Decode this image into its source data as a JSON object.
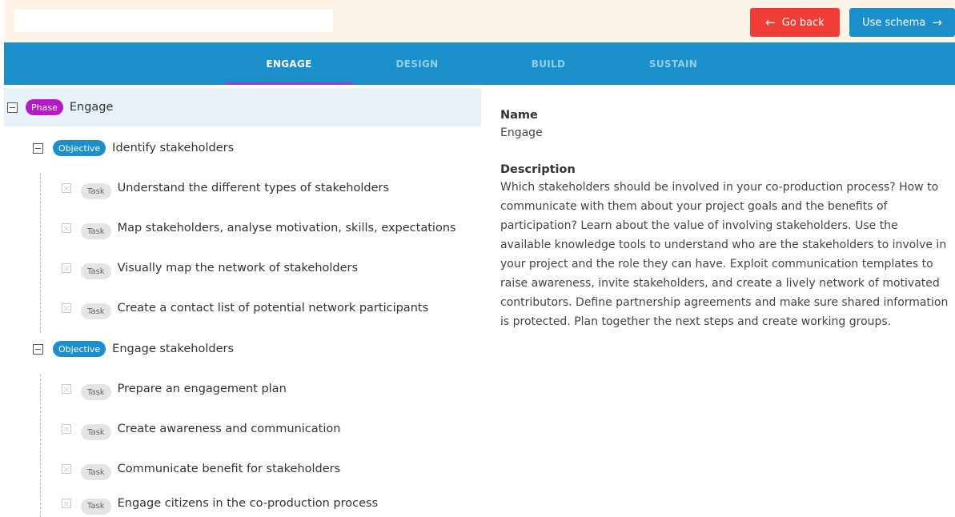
{
  "header": {
    "search_value": "",
    "go_back_label": "Go back",
    "use_schema_label": "Use schema",
    "go_back_color": "#ef3d36",
    "use_schema_color": "#1b8fc9"
  },
  "tabs": [
    {
      "label": "ENGAGE",
      "active": true
    },
    {
      "label": "DESIGN",
      "active": false
    },
    {
      "label": "BUILD",
      "active": false
    },
    {
      "label": "SUSTAIN",
      "active": false
    }
  ],
  "tree": {
    "phase": {
      "badge": "Phase",
      "label": "Engage"
    },
    "objectives": [
      {
        "badge": "Objective",
        "label": "Identify stakeholders",
        "tasks": [
          {
            "badge": "Task",
            "label": "Understand the different types of stakeholders"
          },
          {
            "badge": "Task",
            "label": "Map stakeholders, analyse motivation, skills, expectations"
          },
          {
            "badge": "Task",
            "label": "Visually map the network of stakeholders"
          },
          {
            "badge": "Task",
            "label": "Create a contact list of potential network participants"
          }
        ]
      },
      {
        "badge": "Objective",
        "label": "Engage stakeholders",
        "tasks": [
          {
            "badge": "Task",
            "label": "Prepare an engagement plan"
          },
          {
            "badge": "Task",
            "label": "Create awareness and communication"
          },
          {
            "badge": "Task",
            "label": "Communicate benefit for stakeholders"
          },
          {
            "badge": "Task",
            "label": "Engage citizens in the co-production process"
          }
        ]
      }
    ]
  },
  "detail": {
    "name_heading": "Name",
    "name_value": "Engage",
    "description_heading": "Description",
    "description_value": "Which stakeholders should be involved in your co-production process? How to communicate with them about your project goals and the benefits of participation? Learn about the value of involving stakeholders. Use the available knowledge tools to understand who are the stakeholders to involve in your project and the role they can have. Exploit communication templates to raise awareness, invite stakeholders, and create a lively network of motivated contributors. Define partnership agreements and make sure shared information is protected. Plan together the next steps and create working groups."
  }
}
